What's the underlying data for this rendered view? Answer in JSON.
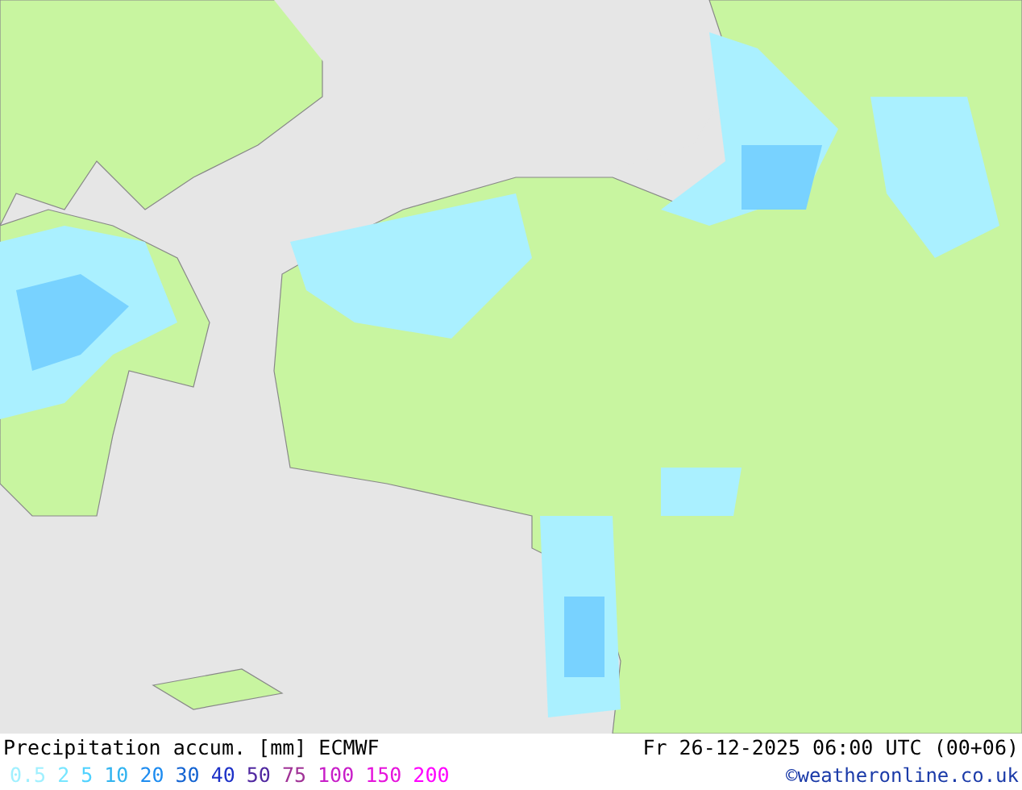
{
  "title": "Precipitation accum. [mm] ECMWF",
  "valid_time": "Fr 26-12-2025 06:00 UTC (00+06)",
  "legend": [
    {
      "label": "0.5",
      "color": "#a0f0ff"
    },
    {
      "label": "2",
      "color": "#78e6ff"
    },
    {
      "label": "5",
      "color": "#50d2ff"
    },
    {
      "label": "10",
      "color": "#32b4f0"
    },
    {
      "label": "20",
      "color": "#1e8cf0"
    },
    {
      "label": "30",
      "color": "#1464d2"
    },
    {
      "label": "40",
      "color": "#1e32c8"
    },
    {
      "label": "50",
      "color": "#5028a0"
    },
    {
      "label": "75",
      "color": "#a03296"
    },
    {
      "label": "100",
      "color": "#c81ec8"
    },
    {
      "label": "150",
      "color": "#e614dc"
    },
    {
      "label": "200",
      "color": "#ff00ff"
    }
  ],
  "copyright": "©weatheronline.co.uk"
}
